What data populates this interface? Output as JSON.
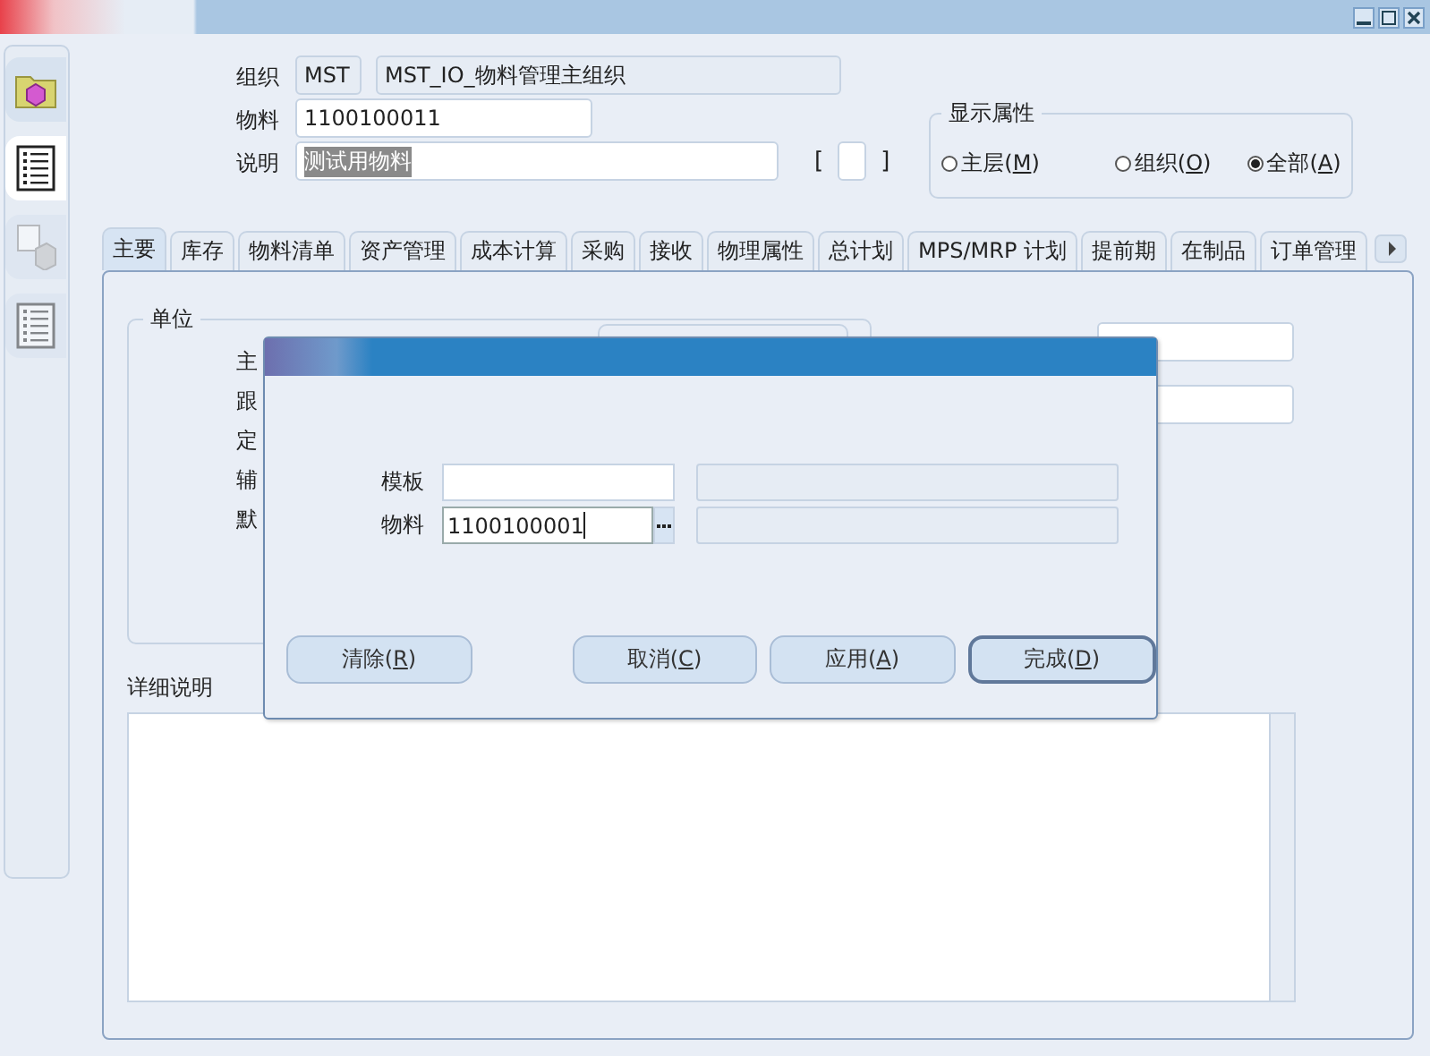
{
  "sidebar": {
    "items": [
      {
        "kind": "folder",
        "selected": false,
        "disabled": false
      },
      {
        "kind": "list",
        "selected": true,
        "disabled": false
      },
      {
        "kind": "form",
        "selected": false,
        "disabled": true
      },
      {
        "kind": "list",
        "selected": false,
        "disabled": true
      }
    ]
  },
  "header": {
    "organization": {
      "label": "组织",
      "code": "MST",
      "name": "MST_IO_物料管理主组织"
    },
    "item": {
      "label": "物料",
      "value": "1100100011"
    },
    "description": {
      "label": "说明",
      "value": "测试用物料",
      "selected": true
    },
    "bracket": {
      "open": "[",
      "close": "]"
    }
  },
  "display_attributes": {
    "title": "显示属性",
    "options": [
      {
        "before": "主层(",
        "key": "M",
        "after": ")",
        "selected": false
      },
      {
        "before": "组织(",
        "key": "O",
        "after": ")",
        "selected": false
      },
      {
        "before": "全部(",
        "key": "A",
        "after": ")",
        "selected": true
      }
    ]
  },
  "tabs": [
    {
      "label": "主要",
      "selected": true
    },
    {
      "label": "库存",
      "selected": false
    },
    {
      "label": "物料清单",
      "selected": false
    },
    {
      "label": "资产管理",
      "selected": false
    },
    {
      "label": "成本计算",
      "selected": false
    },
    {
      "label": "采购",
      "selected": false
    },
    {
      "label": "接收",
      "selected": false
    },
    {
      "label": "物理属性",
      "selected": false
    },
    {
      "label": "总计划",
      "selected": false
    },
    {
      "label": "MPS/MRP 计划",
      "selected": false
    },
    {
      "label": "提前期",
      "selected": false
    },
    {
      "label": "在制品",
      "selected": false
    },
    {
      "label": "订单管理",
      "selected": false
    }
  ],
  "unit_group": {
    "title": "单位",
    "labels": [
      "主",
      "跟",
      "定",
      "辅",
      "默"
    ]
  },
  "details": {
    "label": "详细说明"
  },
  "dialog": {
    "fields": [
      {
        "label": "模板",
        "lov": false,
        "focused": false
      },
      {
        "label": "物料",
        "value": "1100100001",
        "lov": true,
        "focused": true
      }
    ],
    "buttons": [
      {
        "before": "清除(",
        "key": "R",
        "after": ")",
        "default": false
      },
      {
        "before": "取消(",
        "key": "C",
        "after": ")",
        "default": false
      },
      {
        "before": "应用(",
        "key": "A",
        "after": ")",
        "default": false
      },
      {
        "before": "完成(",
        "key": "D",
        "after": ")",
        "default": true
      }
    ]
  }
}
